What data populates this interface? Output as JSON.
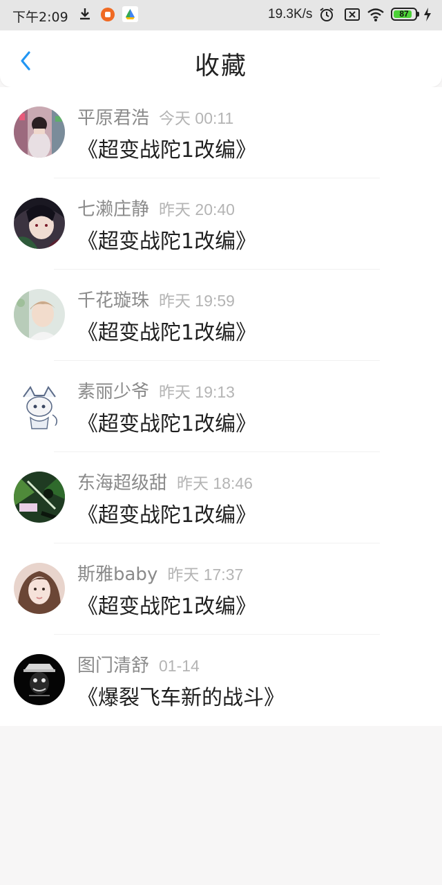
{
  "status_bar": {
    "time": "下午2:09",
    "net_speed": "19.3K/s",
    "battery_level": "87",
    "battery_fraction": 0.87
  },
  "header": {
    "title": "收藏"
  },
  "favorites": [
    {
      "name": "平原君浩",
      "time": "今天 00:11",
      "title": "《超变战陀1改编》"
    },
    {
      "name": "七濑庄静",
      "time": "昨天 20:40",
      "title": "《超变战陀1改编》"
    },
    {
      "name": "千花璇珠",
      "time": "昨天 19:59",
      "title": "《超变战陀1改编》"
    },
    {
      "name": "素丽少爷",
      "time": "昨天 19:13",
      "title": "《超变战陀1改编》"
    },
    {
      "name": "东海超级甜",
      "time": "昨天 18:46",
      "title": "《超变战陀1改编》"
    },
    {
      "name": "斯雅baby",
      "time": "昨天 17:37",
      "title": "《超变战陀1改编》"
    },
    {
      "name": "图门清舒",
      "time": "01-14",
      "title": "《爆裂飞车新的战斗》"
    }
  ],
  "colors": {
    "accent": "#2196f3",
    "background": "#f7f6f6",
    "battery": "#4cd137"
  },
  "icons": {
    "back": "chevron-left-icon",
    "download": "download-icon",
    "alarm": "alarm-icon",
    "sim": "sim-icon",
    "wifi": "wifi-icon",
    "charge": "charge-icon"
  }
}
